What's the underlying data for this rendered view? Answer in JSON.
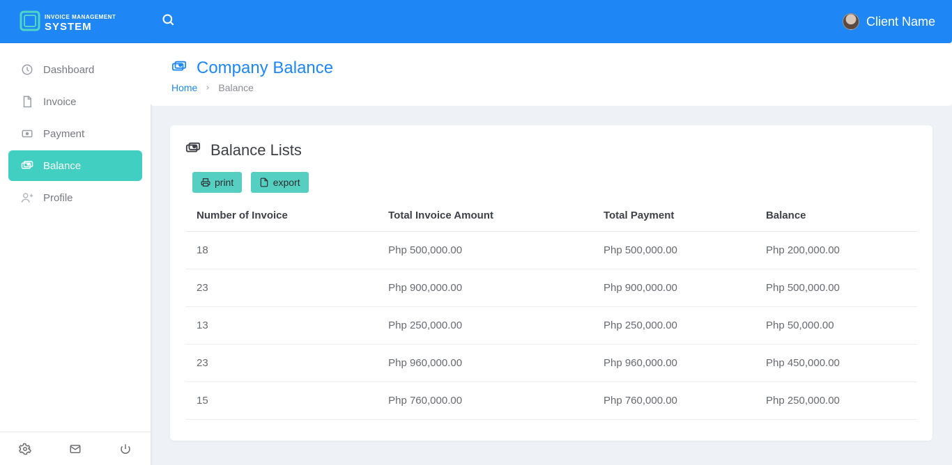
{
  "app_name": "Invoice Management System",
  "user_name": "Client Name",
  "sidebar": {
    "items": [
      {
        "label": "Dashboard",
        "active": false
      },
      {
        "label": "Invoice",
        "active": false
      },
      {
        "label": "Payment",
        "active": false
      },
      {
        "label": "Balance",
        "active": true
      },
      {
        "label": "Profile",
        "active": false
      }
    ]
  },
  "page": {
    "title": "Company Balance",
    "breadcrumb_home": "Home",
    "breadcrumb_current": "Balance"
  },
  "card": {
    "title": "Balance Lists",
    "print_label": "print",
    "export_label": "export"
  },
  "table": {
    "headers": [
      "Number of Invoice",
      "Total Invoice Amount",
      "Total Payment",
      "Balance"
    ],
    "rows": [
      {
        "num": "18",
        "amount": "Php 500,000.00",
        "payment": "Php 500,000.00",
        "balance": "Php 200,000.00"
      },
      {
        "num": "23",
        "amount": "Php 900,000.00",
        "payment": "Php 900,000.00",
        "balance": "Php 500,000.00"
      },
      {
        "num": "13",
        "amount": "Php 250,000.00",
        "payment": "Php 250,000.00",
        "balance": "Php 50,000.00"
      },
      {
        "num": "23",
        "amount": "Php 960,000.00",
        "payment": "Php 960,000.00",
        "balance": "Php 450,000.00"
      },
      {
        "num": "15",
        "amount": "Php 760,000.00",
        "payment": "Php 760,000.00",
        "balance": "Php 250,000.00"
      }
    ]
  }
}
